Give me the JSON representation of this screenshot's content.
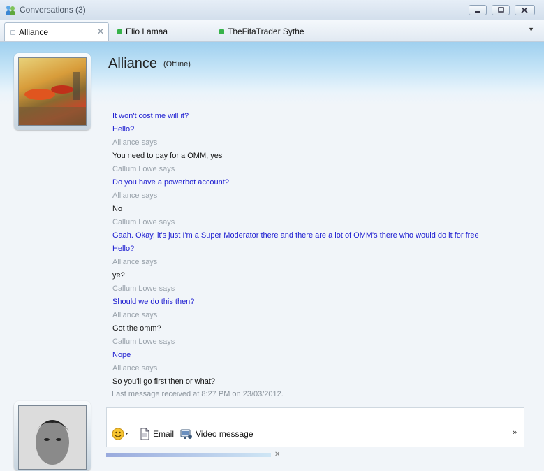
{
  "window": {
    "title": "Conversations (3)"
  },
  "tabs": [
    {
      "label": "Alliance",
      "status_color": "#b8c2cc"
    },
    {
      "label": "Elio Lamaa",
      "status_color": "#37b34a"
    },
    {
      "label": "TheFifaTrader Sythe",
      "status_color": "#37b34a"
    }
  ],
  "contact": {
    "name": "Alliance",
    "status": "(Offline)"
  },
  "messages": [
    {
      "text": "It won't cost me will it?",
      "kind": "me"
    },
    {
      "text": "Hello?",
      "kind": "me"
    },
    {
      "text": "Alliance says",
      "kind": "says"
    },
    {
      "text": "You need to pay for a OMM, yes",
      "kind": "them"
    },
    {
      "text": "Callum Lowe says",
      "kind": "says"
    },
    {
      "text": "Do you have a powerbot account?",
      "kind": "me"
    },
    {
      "text": "Alliance says",
      "kind": "says"
    },
    {
      "text": "No",
      "kind": "them"
    },
    {
      "text": "Callum Lowe says",
      "kind": "says"
    },
    {
      "text": "Gaah. Okay, it's just I'm a Super Moderator there and there are a lot of OMM's there who would do it for free",
      "kind": "me"
    },
    {
      "text": "Hello?",
      "kind": "me"
    },
    {
      "text": "Alliance says",
      "kind": "says"
    },
    {
      "text": "ye?",
      "kind": "them"
    },
    {
      "text": "Callum Lowe says",
      "kind": "says"
    },
    {
      "text": "Should we do this then?",
      "kind": "me"
    },
    {
      "text": "Alliance says",
      "kind": "says"
    },
    {
      "text": "Got the omm?",
      "kind": "them"
    },
    {
      "text": "Callum Lowe says",
      "kind": "says"
    },
    {
      "text": "Nope",
      "kind": "me"
    },
    {
      "text": "Alliance says",
      "kind": "says"
    },
    {
      "text": "So you'll go first then or what?",
      "kind": "them"
    }
  ],
  "last_message": "Last message received at 8:27 PM on 23/03/2012.",
  "toolbar": {
    "email_label": "Email",
    "video_label": "Video message",
    "more_label": "»"
  },
  "colors": {
    "self_text": "#1b1bd0",
    "other_text": "#111111",
    "says_text": "#9aa3ac",
    "online": "#37b34a",
    "offline": "#b8c2cc"
  }
}
